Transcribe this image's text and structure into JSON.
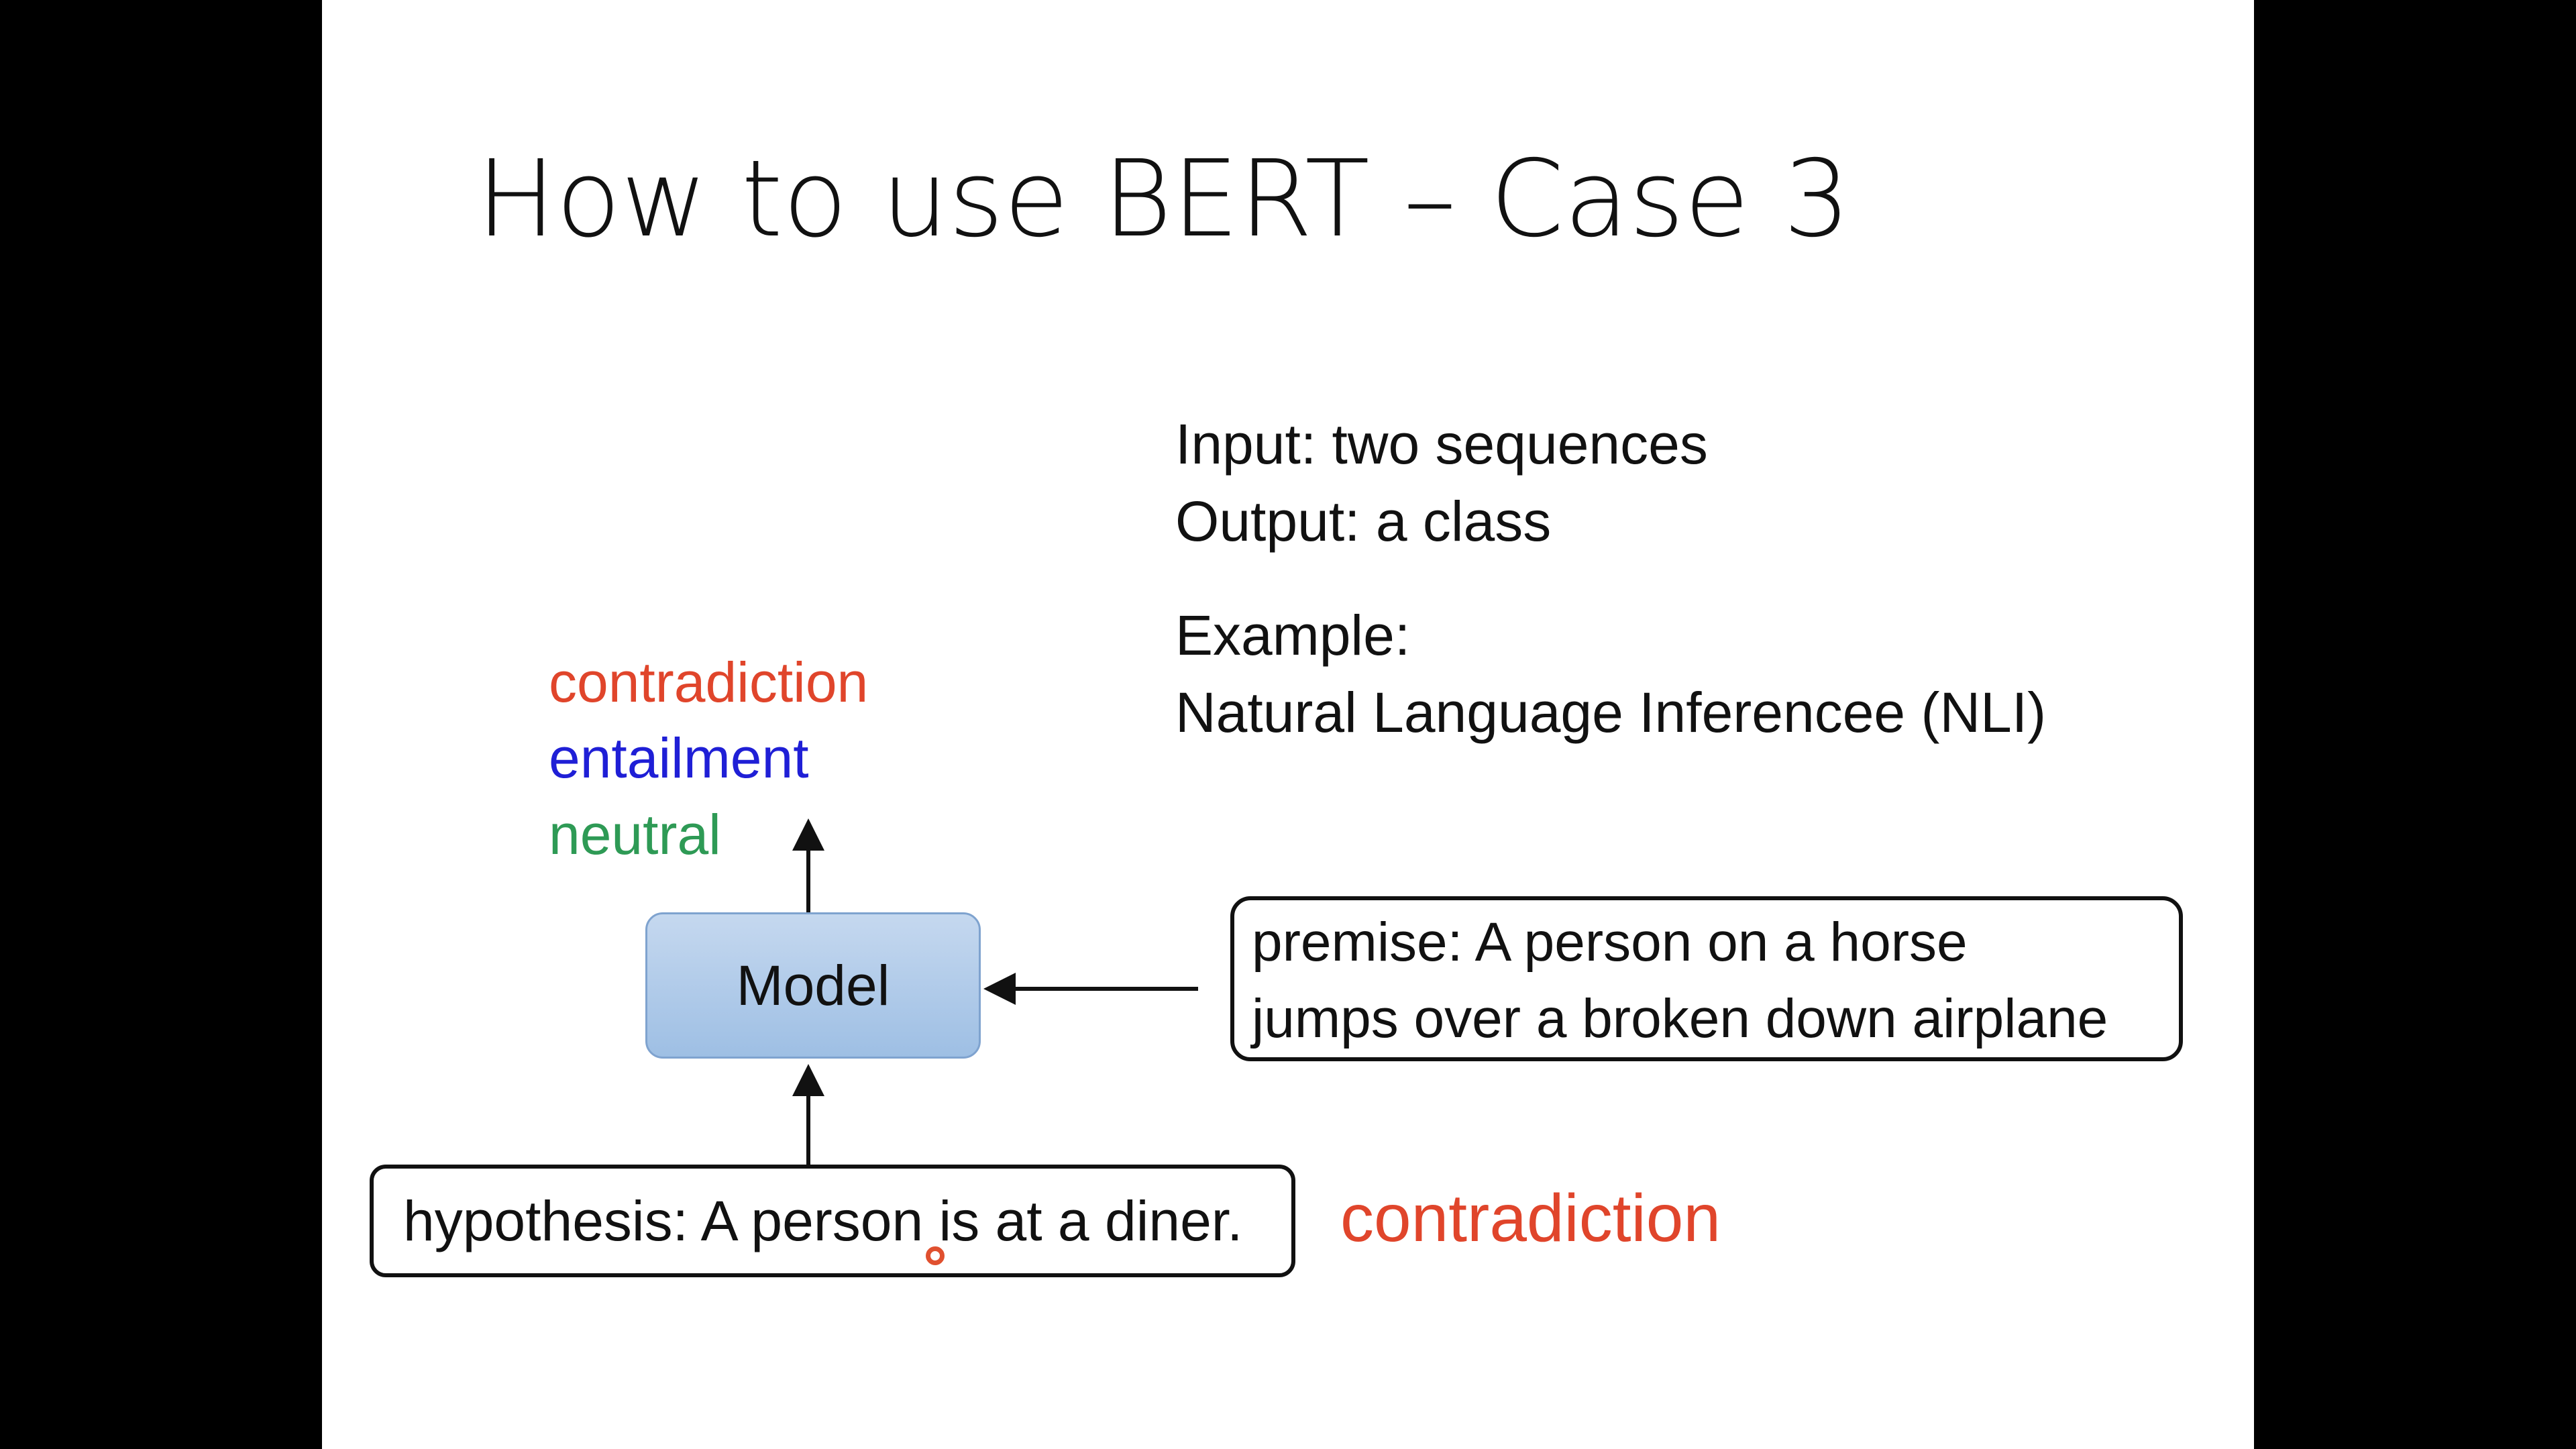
{
  "slide": {
    "title": "How to use BERT – Case 3",
    "info_lines": [
      "Input: two sequences",
      "Output: a class"
    ],
    "example_lines": [
      "Example:",
      "Natural Language Inferencee (NLI)"
    ]
  },
  "classes": [
    {
      "label": "contradiction",
      "color": "#e0452b"
    },
    {
      "label": "entailment",
      "color": "#1f1fd6"
    },
    {
      "label": "neutral",
      "color": "#2e9a55"
    }
  ],
  "model": {
    "label": "Model"
  },
  "premise": {
    "lines": [
      "premise: A person on a horse",
      "jumps over a broken down airplane"
    ]
  },
  "hypothesis": {
    "text": "hypothesis: A person is at a diner."
  },
  "answer": {
    "label": "contradiction",
    "color": "#e0452b"
  },
  "colors": {
    "model_fill": "#b3cdea",
    "background": "#000000",
    "slide": "#ffffff"
  }
}
